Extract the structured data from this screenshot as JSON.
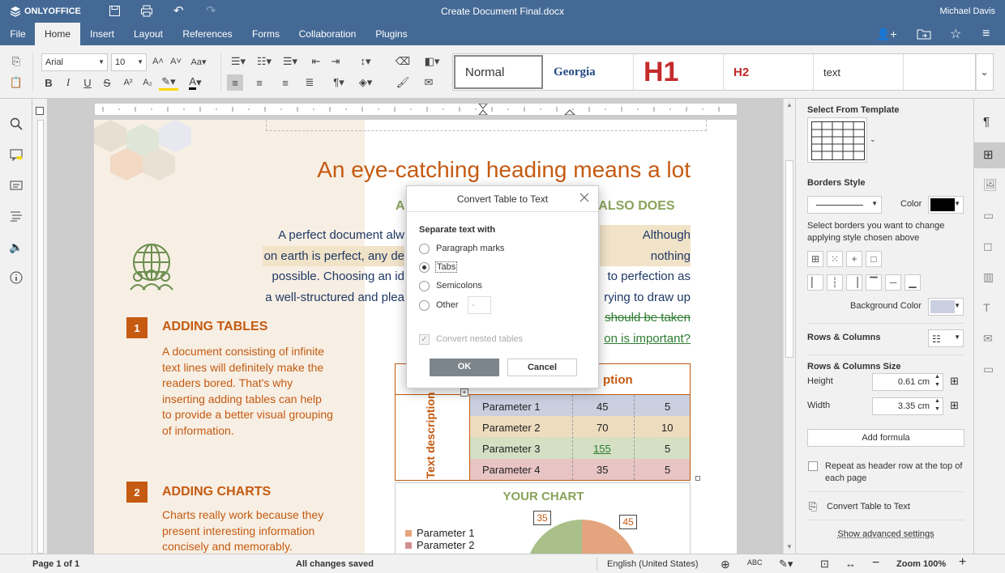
{
  "app": {
    "brand": "ONLYOFFICE",
    "doc_title": "Create Document Final.docx",
    "user": "Michael Davis"
  },
  "menu": [
    "File",
    "Home",
    "Insert",
    "Layout",
    "References",
    "Forms",
    "Collaboration",
    "Plugins"
  ],
  "toolbar": {
    "font_name": "Arial",
    "font_size": "10"
  },
  "styles": {
    "normal": "Normal",
    "georgia": "Georgia",
    "h1": "H1",
    "h2": "H2",
    "text": "text"
  },
  "document": {
    "heading": "An eye-catching heading means a lot",
    "subheading_left": "A",
    "subheading_right": "G ALSO DOES",
    "para_lines": [
      {
        "l": "A perfect document alw",
        "r": "Although nothing"
      },
      {
        "l": "on earth is perfect, any de",
        "r": " to perfection as"
      },
      {
        "l": "possible. Choosing an id",
        "r": "rying to draw up"
      },
      {
        "l": "a well-structured and plea",
        "r": "should be taken"
      },
      {
        "l": "",
        "r": "on is important?"
      }
    ],
    "section1": {
      "num": "1",
      "title": "ADDING TABLES",
      "lines": [
        "A document consisting of infinite",
        "text lines will definitely make the",
        "readers   bored.   That's   why",
        "inserting adding tables can help",
        "to provide a better visual grouping",
        "of information."
      ]
    },
    "section2": {
      "num": "2",
      "title": "ADDING CHARTS",
      "lines": [
        "Charts really work because they",
        "present   interesting   information",
        "concisely     and     memorably."
      ]
    },
    "table": {
      "header_fragment": "ption",
      "side_label": "Text description",
      "rows": [
        {
          "name": "Parameter 1",
          "a": "45",
          "b": "5"
        },
        {
          "name": "Parameter 2",
          "a": "70",
          "b": "10"
        },
        {
          "name": "Parameter 3",
          "a": "155",
          "b": "5"
        },
        {
          "name": "Parameter 4",
          "a": "35",
          "b": "5"
        }
      ]
    },
    "chart": {
      "title": "YOUR CHART",
      "label1": "35",
      "label2": "45",
      "legend": [
        "Parameter 1",
        "Parameter 2"
      ]
    }
  },
  "dialog": {
    "title": "Convert Table to Text",
    "group_label": "Separate text with",
    "options": [
      "Paragraph marks",
      "Tabs",
      "Semicolons",
      "Other"
    ],
    "selected": "Tabs",
    "other_value": "-",
    "nested_label": "Convert nested tables",
    "ok": "OK",
    "cancel": "Cancel"
  },
  "panel": {
    "select_template": "Select From Template",
    "borders_style": "Borders Style",
    "color": "Color",
    "borders_hint": "Select borders you want to change applying style chosen above",
    "background_color": "Background Color",
    "rows_columns": "Rows & Columns",
    "rows_columns_size": "Rows & Columns Size",
    "height_label": "Height",
    "height_value": "0.61 cm",
    "width_label": "Width",
    "width_value": "3.35 cm",
    "add_formula": "Add formula",
    "repeat_header": "Repeat as header row at the top of each page",
    "convert_table": "Convert Table to Text",
    "advanced": "Show advanced settings"
  },
  "status": {
    "page": "Page 1 of 1",
    "saved": "All changes saved",
    "language": "English (United States)",
    "zoom": "Zoom 100%"
  },
  "colors": {
    "header": "#446995",
    "accent_orange": "#c55a11",
    "accent_green": "#8aa25a",
    "dark_text": "#1f3864"
  }
}
